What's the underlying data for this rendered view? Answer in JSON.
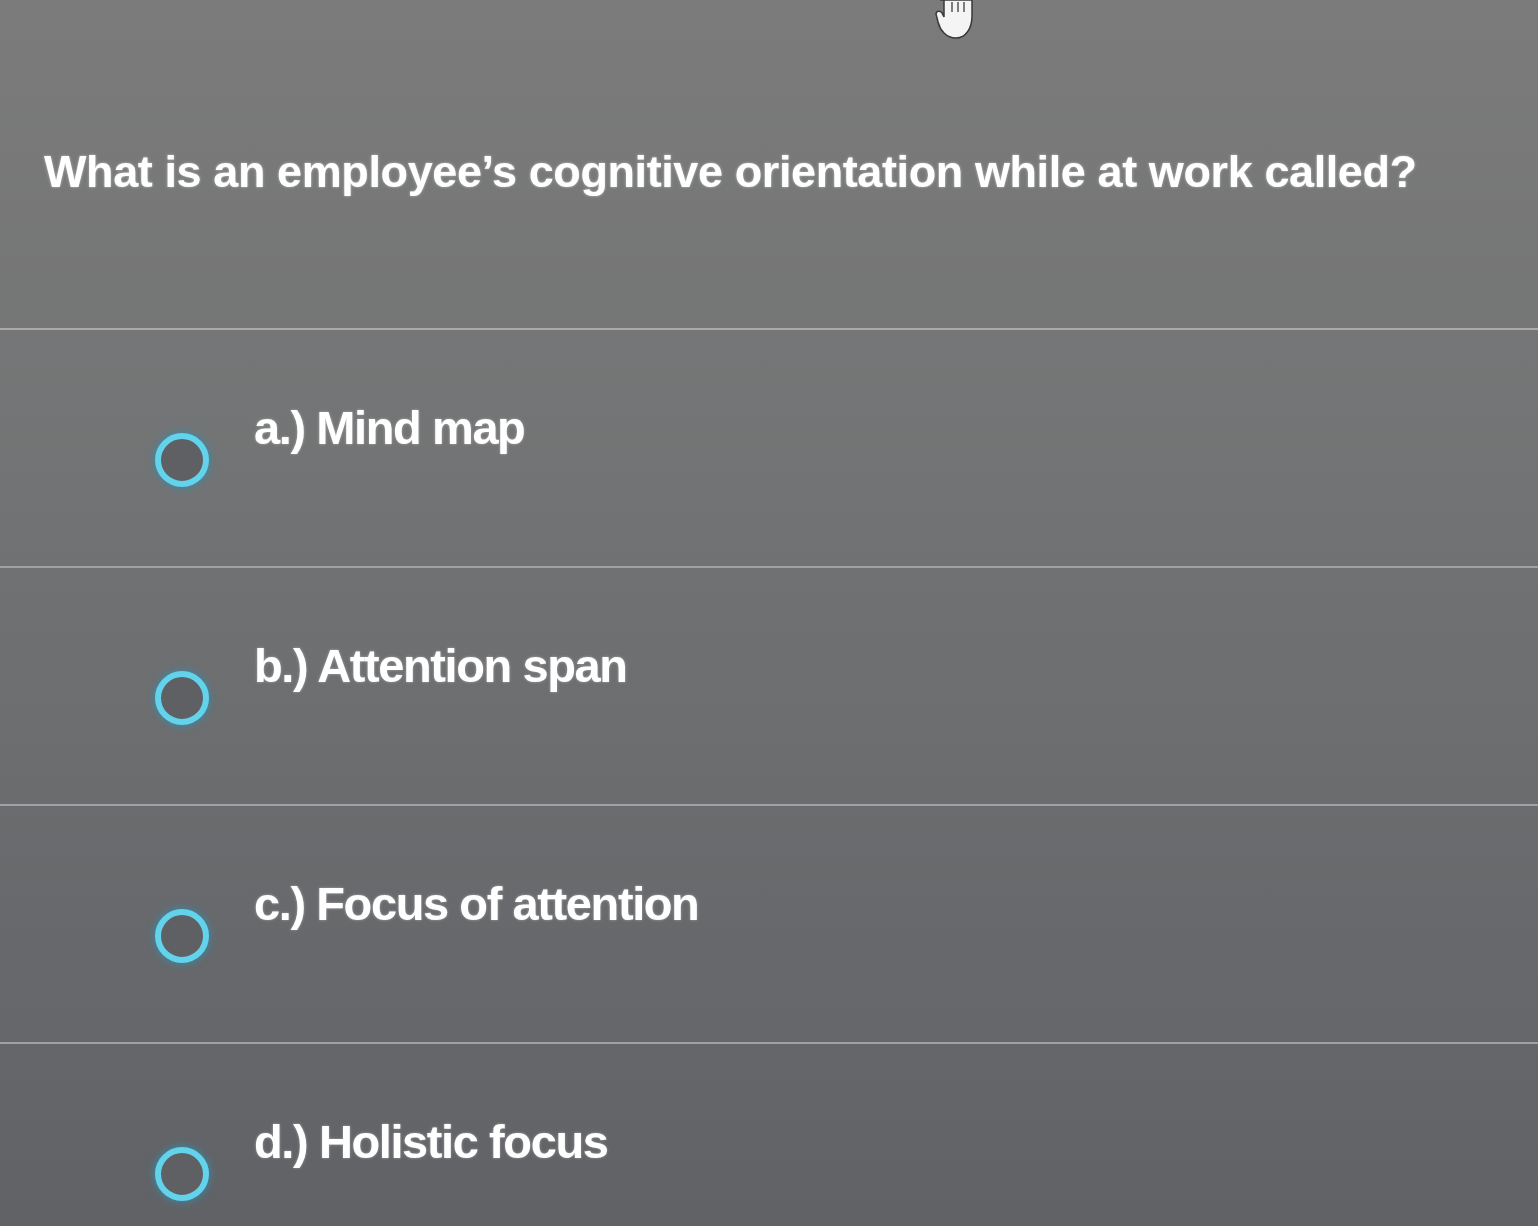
{
  "question": {
    "text": "What is an employee’s cognitive orientation while at work called?"
  },
  "options": [
    {
      "label": "a.) Mind map",
      "selected": false
    },
    {
      "label": "b.) Attention span",
      "selected": false
    },
    {
      "label": "c.) Focus of attention",
      "selected": false
    },
    {
      "label": "d.) Holistic focus",
      "selected": false
    }
  ]
}
